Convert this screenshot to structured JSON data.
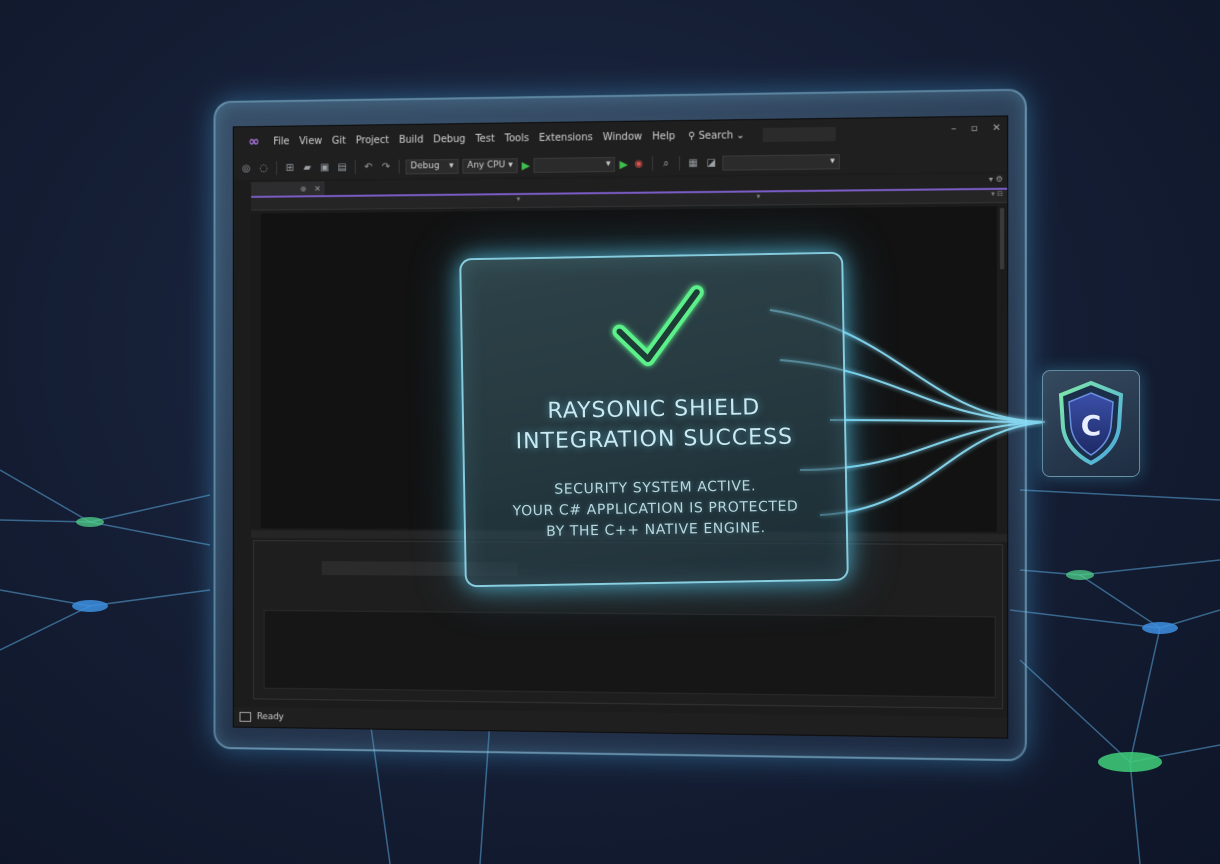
{
  "menu": {
    "items": [
      "File",
      "View",
      "Git",
      "Project",
      "Build",
      "Debug",
      "Test",
      "Tools",
      "Extensions",
      "Window",
      "Help"
    ],
    "search_label": "Search"
  },
  "toolbar": {
    "configuration": "Debug",
    "platform": "Any CPU"
  },
  "status": {
    "text": "Ready"
  },
  "card": {
    "title_line1": "RAYSONIC SHIELD",
    "title_line2": "INTEGRATION SUCCESS",
    "body_line1": "SECURITY SYSTEM ACTIVE.",
    "body_line2": "YOUR C# APPLICATION IS PROTECTED",
    "body_line3": "BY THE C++ NATIVE ENGINE."
  },
  "badge": {
    "letter": "C"
  },
  "colors": {
    "accent_green": "#5cf08a",
    "accent_cyan": "#8fe6ff",
    "vs_purple": "#7a5cc4",
    "background": "#141d33"
  },
  "icons": [
    "visual-studio-logo-icon",
    "search-icon",
    "minimize-icon",
    "maximize-icon",
    "close-icon",
    "start-debugging-icon",
    "checkmark-icon",
    "shield-icon"
  ]
}
